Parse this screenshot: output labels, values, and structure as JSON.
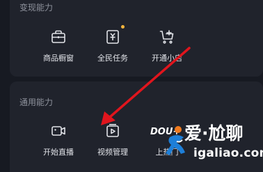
{
  "monetization": {
    "title": "变现能力",
    "items": [
      {
        "label": "商品橱窗",
        "icon": "shop-window-icon"
      },
      {
        "label": "全民任务",
        "icon": "task-icon"
      },
      {
        "label": "开通小店",
        "icon": "cart-plus-icon"
      }
    ]
  },
  "common": {
    "title": "通用能力",
    "items": [
      {
        "label": "开始直播",
        "icon": "live-camera-icon"
      },
      {
        "label": "视频管理",
        "icon": "video-manage-icon"
      },
      {
        "label": "上热门",
        "icon": "hot-icon"
      }
    ]
  },
  "watermark": {
    "left_text": "DOU+",
    "main_text": "爱·尬聊",
    "url": "igaliao.com"
  },
  "colors": {
    "background": "#171a22",
    "card": "#20232c",
    "arrow": "#e0151d",
    "badge_dot": "#f4b53d"
  }
}
